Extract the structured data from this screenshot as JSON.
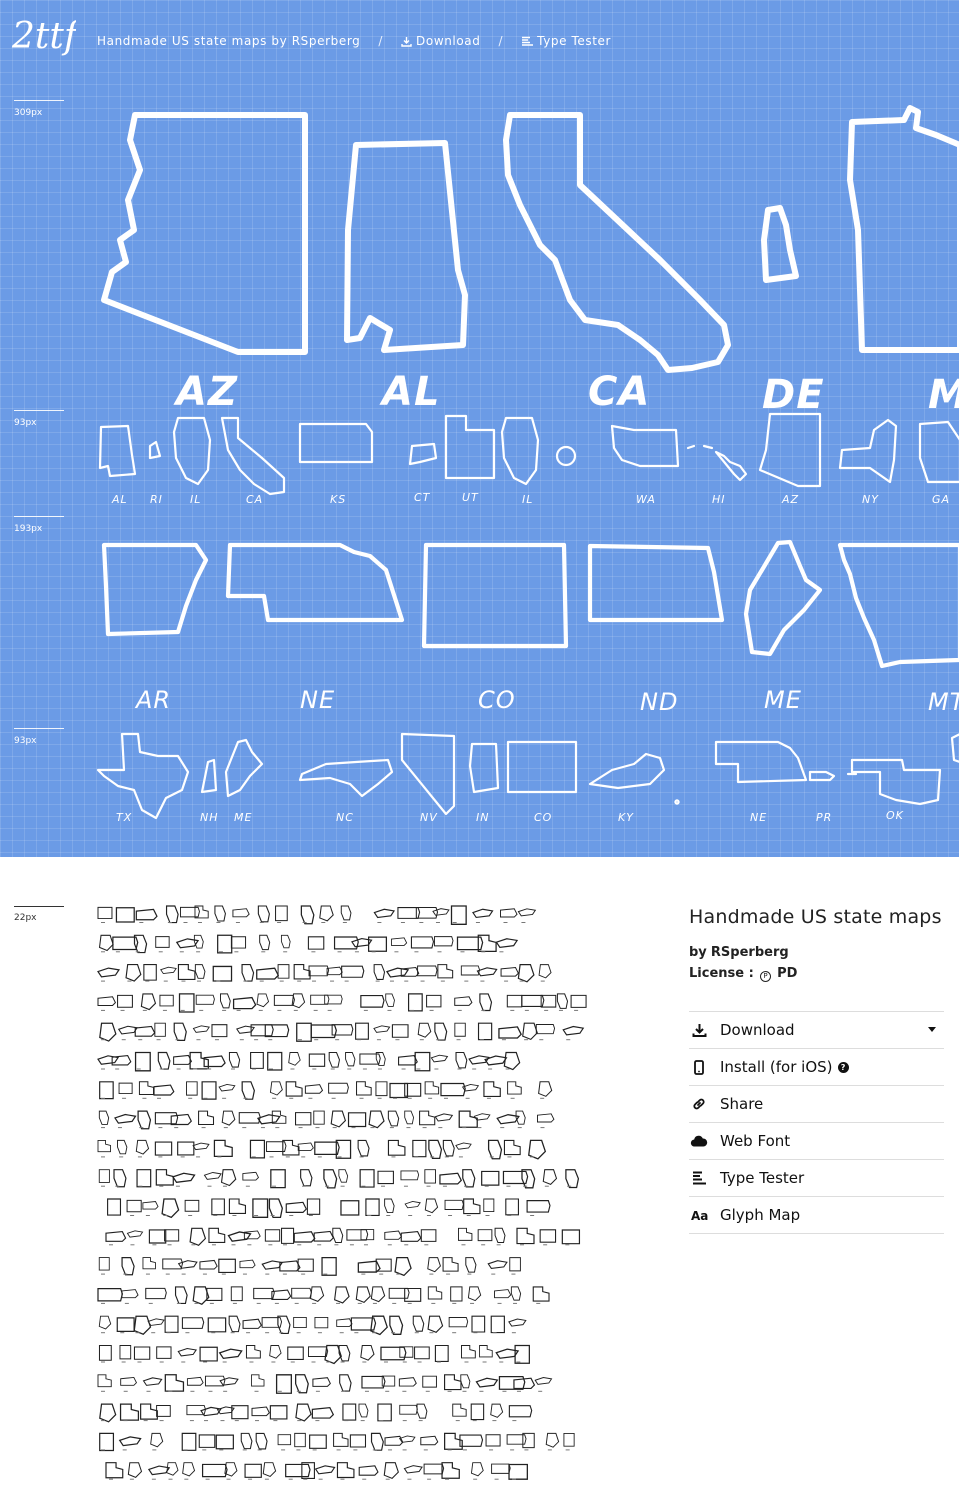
{
  "header": {
    "logo_text": "2ttf",
    "title": "Handmade US state maps by RSperberg",
    "separator": "/",
    "download_label": "Download",
    "type_tester_label": "Type Tester"
  },
  "specimen": {
    "size_markers": [
      "309px",
      "93px",
      "193px",
      "93px",
      "22px"
    ],
    "row_309_labels": [
      "AZ",
      "AL",
      "CA",
      "DE",
      "M"
    ],
    "row_93a_labels": [
      "AL",
      "RI",
      "IL",
      "CA",
      "KS",
      "CT",
      "UT",
      "IL",
      "WA",
      "HI",
      "AZ",
      "NY",
      "GA"
    ],
    "row_193_labels": [
      "AR",
      "NE",
      "CO",
      "ND",
      "ME",
      "MT"
    ],
    "row_93b_labels": [
      "TX",
      "NH",
      "ME",
      "NC",
      "NV",
      "IN",
      "CO",
      "KY",
      "NE",
      "PR",
      "OK"
    ]
  },
  "sidebar": {
    "title": "Handmade US state maps",
    "by_prefix": "by",
    "author": "RSperberg",
    "license_label": "License :",
    "license_value": "PD",
    "license_icon": "ⓟ",
    "actions": [
      {
        "label": "Download",
        "icon": "download-icon"
      },
      {
        "label": "Install (for iOS)",
        "icon": "phone-icon"
      },
      {
        "label": "Share",
        "icon": "link-icon"
      },
      {
        "label": "Web Font",
        "icon": "cloud-icon"
      },
      {
        "label": "Type Tester",
        "icon": "type-tester-icon"
      },
      {
        "label": "Glyph Map",
        "icon": "glyph-map-icon"
      }
    ],
    "help_glyph": "?"
  }
}
